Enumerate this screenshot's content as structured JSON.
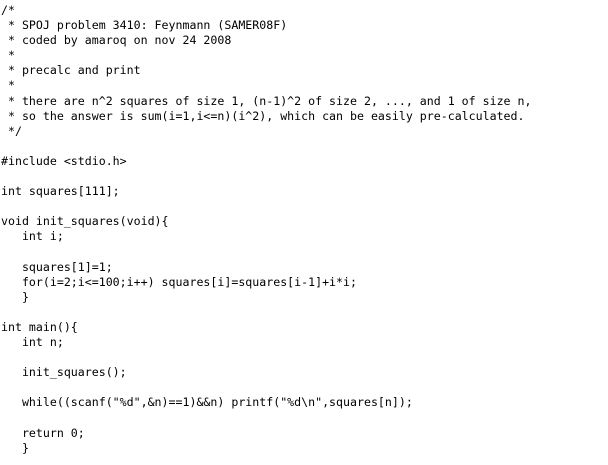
{
  "code": {
    "lines": [
      "/*",
      " * SPOJ problem 3410: Feynmann (SAMER08F)",
      " * coded by amaroq on nov 24 2008",
      " *",
      " * precalc and print",
      " *",
      " * there are n^2 squares of size 1, (n-1)^2 of size 2, ..., and 1 of size n,",
      " * so the answer is sum(i=1,i<=n)(i^2), which can be easily pre-calculated.",
      " */",
      "",
      "#include <stdio.h>",
      "",
      "int squares[111];",
      "",
      "void init_squares(void){",
      "   int i;",
      "",
      "   squares[1]=1;",
      "   for(i=2;i<=100;i++) squares[i]=squares[i-1]+i*i;",
      "   }",
      "",
      "int main(){",
      "   int n;",
      "",
      "   init_squares();",
      "",
      "   while((scanf(\"%d\",&n)==1)&&n) printf(\"%d\\n\",squares[n]);",
      "",
      "   return 0;",
      "   }"
    ]
  },
  "colors": {
    "background": "#ffffff",
    "text": "#000000"
  }
}
